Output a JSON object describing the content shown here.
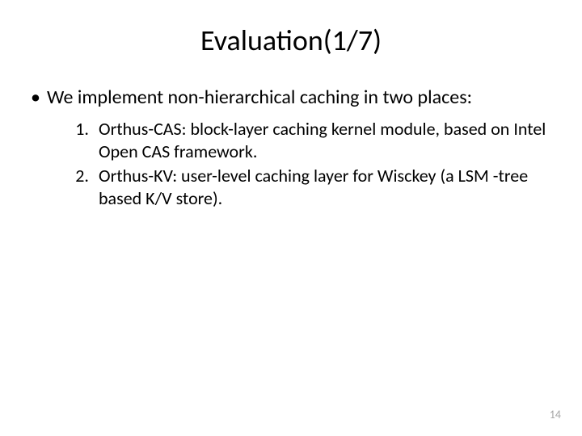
{
  "title": "Evaluation(1/7)",
  "bullets": [
    "We implement non-hierarchical caching in two places:"
  ],
  "numbered": [
    {
      "n": "1.",
      "text": "Orthus-CAS: block-layer caching kernel module, based on Intel Open CAS framework."
    },
    {
      "n": "2.",
      "text": "Orthus-KV: user-level caching layer for Wisckey (a LSM -tree based K/V store)."
    }
  ],
  "page_number": "14"
}
